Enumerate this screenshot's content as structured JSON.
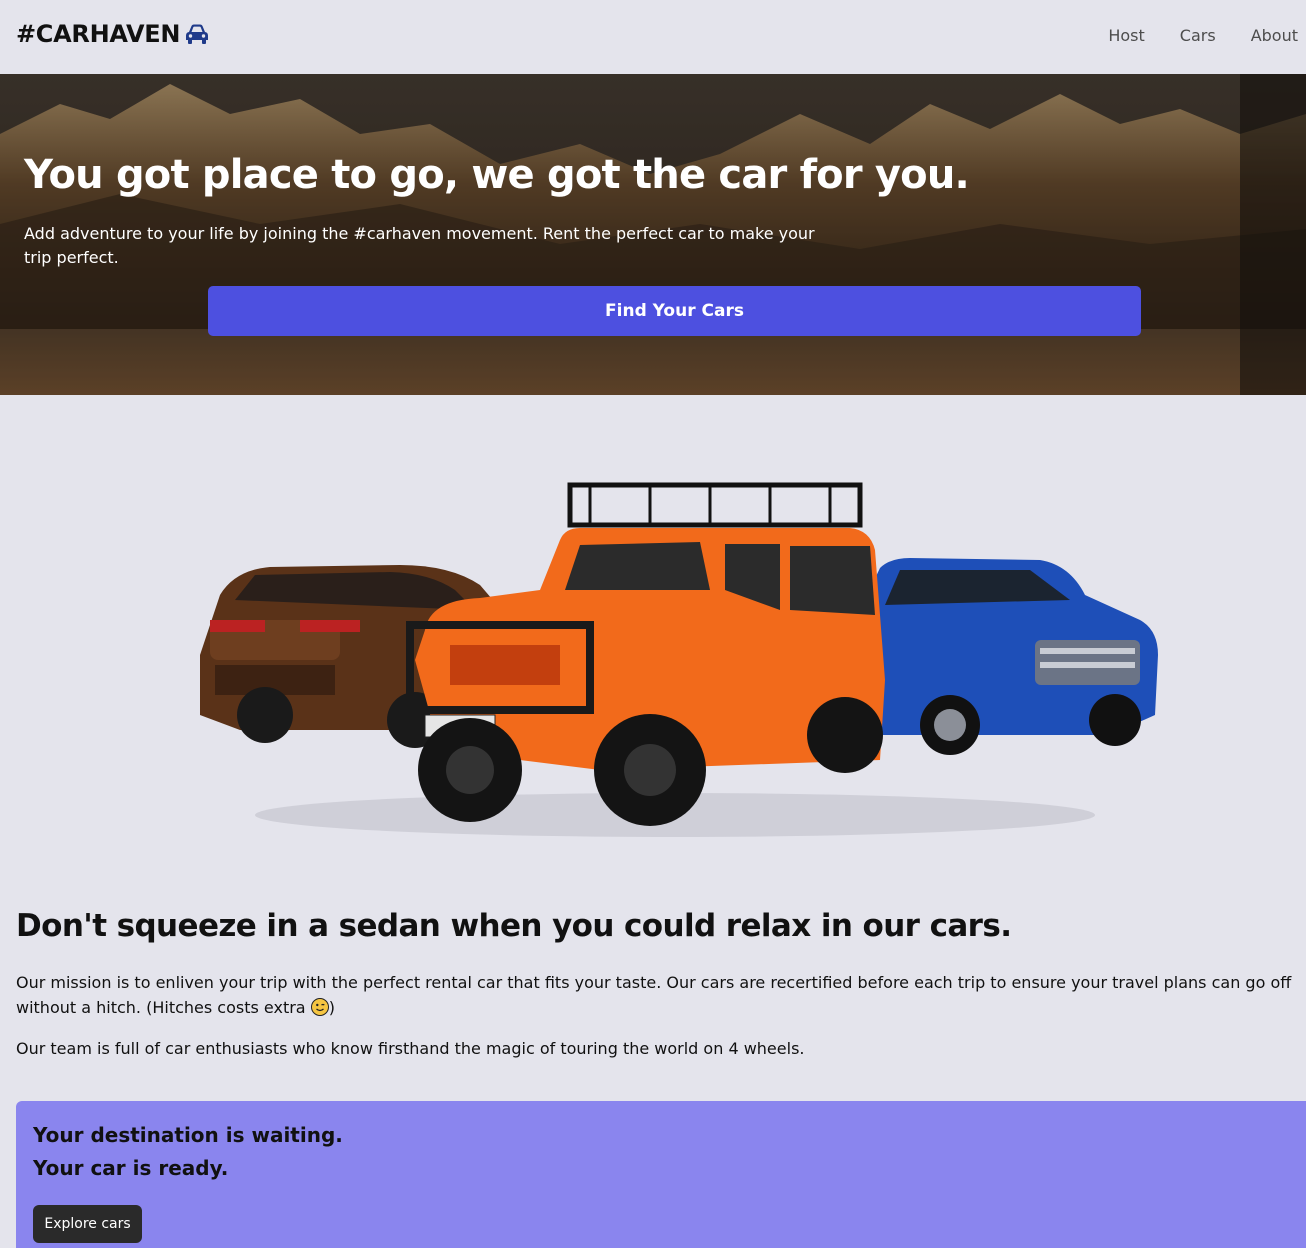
{
  "header": {
    "logo_text": "#CARHAVEN",
    "logo_icon": "car-icon",
    "nav": [
      {
        "label": "Host"
      },
      {
        "label": "Cars"
      },
      {
        "label": "About"
      }
    ]
  },
  "hero": {
    "title": "You got place to go, we got the car for you.",
    "subtitle": "Add adventure to your life by joining the #carhaven movement. Rent the perfect car to make your trip perfect.",
    "button_label": "Find Your Cars",
    "button_color": "#4d50e0"
  },
  "about": {
    "title": "Don't squeeze in a sedan when you could relax in our cars.",
    "paragraph1_text": "Our mission is to enliven your trip with the perfect rental car that fits your taste. Our cars are recertified before each trip to ensure your travel plans can go off without a hitch. (Hitches costs extra ",
    "paragraph1_end": ")",
    "emoji_icon": "winking-face-icon",
    "paragraph2": "Our team is full of car enthusiasts who know firsthand the magic of touring the world on 4 wheels."
  },
  "cta": {
    "line1": "Your destination is waiting.",
    "line2": "Your car is ready.",
    "button_label": "Explore cars",
    "background": "#8a85ee"
  }
}
